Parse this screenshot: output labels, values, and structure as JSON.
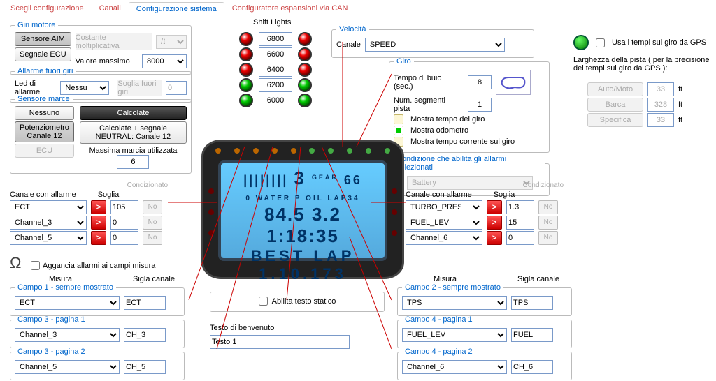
{
  "tabs": [
    "Scegli configurazione",
    "Canali",
    "Configurazione sistema",
    "Configuratore espansioni via CAN"
  ],
  "giri": {
    "legend": "Giri motore",
    "sensore": "Sensore AIM",
    "ecu": "Segnale ECU",
    "cm": "Costante moltiplicativa",
    "cmv": "/1",
    "vmax": "Valore massimo",
    "vmaxv": "8000"
  },
  "afg": {
    "legend": "Allarme fuori giri",
    "led": "Led di allarme",
    "ledv": "Nessuno",
    "sfg": "Soglia fuori giri",
    "sfgv": "0"
  },
  "marce": {
    "legend": "Sensore marce",
    "none": "Nessuno",
    "calc": "Calcolate",
    "calc2": "Calcolate + segnale\nNEUTRAL: Canale 12",
    "pot1": "Potenziometro",
    "pot2": "Canale 12",
    "ecu": "ECU",
    "mmu": "Massima marcia utilizzata",
    "mmuv": "6"
  },
  "shift": {
    "legend": "Shift Lights",
    "rows": [
      "6800",
      "6600",
      "6400",
      "6200",
      "6000"
    ]
  },
  "vel": {
    "legend": "Velocità",
    "ch": "Canale",
    "chv": "SPEED"
  },
  "giro": {
    "legend": "Giro",
    "tb": "Tempo di buio\n(sec.)",
    "tbv": "8",
    "ns": "Num. segmenti pista",
    "nsv": "1",
    "mtg": "Mostra tempo del giro",
    "mo": "Mostra odometro",
    "mtc": "Mostra tempo corrente sul giro"
  },
  "cond": {
    "legend": "Condizione che abilita gli allarmi selezionati",
    "sel": "Battery",
    "lab": "Condizionato"
  },
  "alL": {
    "hdr1": "Canale con allarme",
    "hdr2": "Soglia",
    "rows": [
      {
        "ch": "ECT",
        "v": "105"
      },
      {
        "ch": "Channel_3",
        "v": "0"
      },
      {
        "ch": "Channel_5",
        "v": "0"
      }
    ]
  },
  "alR": {
    "hdr1": "Canale con allarme",
    "hdr2": "Soglia",
    "rows": [
      {
        "ch": "TURBO_PRESS",
        "v": "1.3"
      },
      {
        "ch": "FUEL_LEV",
        "v": "15"
      },
      {
        "ch": "Channel_6",
        "v": "0"
      }
    ]
  },
  "aggancia": "Aggancia allarmi ai campi misura",
  "mis": "Misura",
  "sigla": "Sigla canale",
  "c1": {
    "legend": "Campo 1 - sempre mostrato",
    "sel": "ECT",
    "sig": "ECT"
  },
  "c3a": {
    "legend": "Campo 3 - pagina 1",
    "sel": "Channel_3",
    "sig": "CH_3"
  },
  "c3b": {
    "legend": "Campo 3 - pagina 2",
    "sel": "Channel_5",
    "sig": "CH_5"
  },
  "c2": {
    "legend": "Campo 2 - sempre mostrato",
    "sel": "TPS",
    "sig": "TPS"
  },
  "c4a": {
    "legend": "Campo 4 - pagina 1",
    "sel": "FUEL_LEV",
    "sig": "FUEL"
  },
  "c4b": {
    "legend": "Campo 4 - pagina 2",
    "sel": "Channel_6",
    "sig": "CH_6"
  },
  "ats": "Abilita testo statico",
  "tbv": "Testo di benvenuto",
  "txt1": "Testo 1",
  "gps": {
    "chk": "Usa i tempi sul giro da GPS",
    "note": "Larghezza della pista ( per la precisione dei tempi sul giro da GPS ):",
    "rows": [
      {
        "b": "Auto/Moto",
        "v": "33",
        "u": "ft"
      },
      {
        "b": "Barca",
        "v": "328",
        "u": "ft"
      },
      {
        "b": "Specifica",
        "v": "33",
        "u": "ft"
      }
    ]
  },
  "no": "No",
  "gt": ">"
}
